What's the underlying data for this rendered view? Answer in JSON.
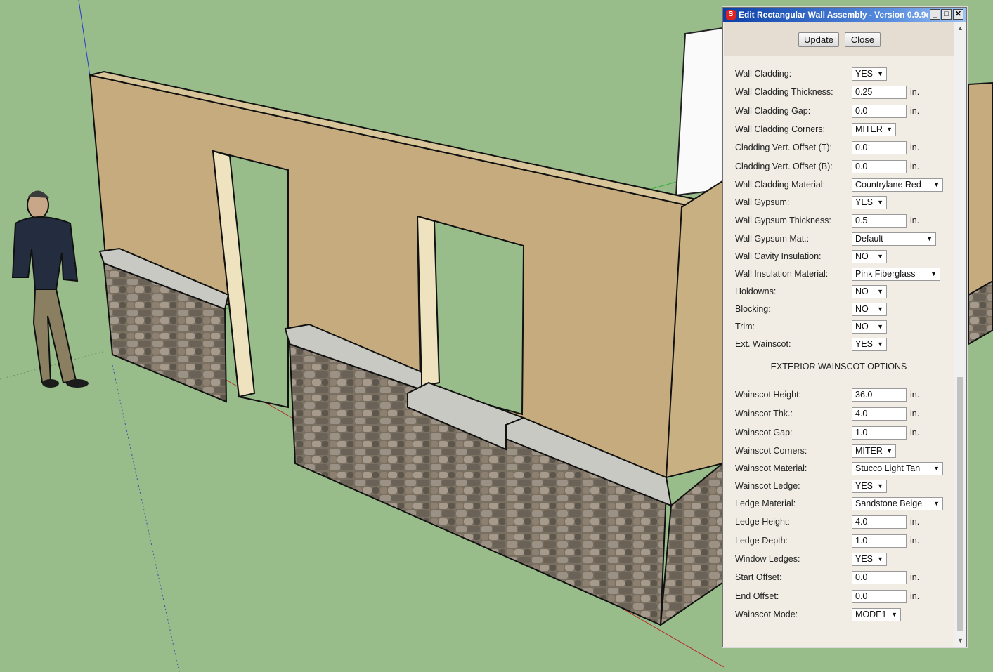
{
  "dialog": {
    "title": "Edit Rectangular Wall Assembly - Version 0.9.9c",
    "buttons": {
      "update": "Update",
      "close": "Close"
    },
    "window_controls": {
      "minimize": "_",
      "maximize": "□",
      "close": "✕"
    },
    "fields": [
      {
        "label": "Wall Cladding:",
        "type": "select",
        "value": "YES"
      },
      {
        "label": "Wall Cladding Thickness:",
        "type": "input",
        "value": "0.25",
        "unit": "in."
      },
      {
        "label": "Wall Cladding Gap:",
        "type": "input",
        "value": "0.0",
        "unit": "in."
      },
      {
        "label": "Wall Cladding Corners:",
        "type": "select",
        "value": "MITER"
      },
      {
        "label": "Cladding Vert. Offset (T):",
        "type": "input",
        "value": "0.0",
        "unit": "in."
      },
      {
        "label": "Cladding Vert. Offset (B):",
        "type": "input",
        "value": "0.0",
        "unit": "in."
      },
      {
        "label": "Wall Cladding Material:",
        "type": "select",
        "value": "Countrylane Red"
      },
      {
        "label": "Wall Gypsum:",
        "type": "select",
        "value": "YES"
      },
      {
        "label": "Wall Gypsum Thickness:",
        "type": "input",
        "value": "0.5",
        "unit": "in."
      },
      {
        "label": "Wall Gypsum Mat.:",
        "type": "select",
        "value": "Default"
      },
      {
        "label": "Wall Cavity Insulation:",
        "type": "select",
        "value": "NO"
      },
      {
        "label": "Wall Insulation Material:",
        "type": "select",
        "value": "Pink Fiberglass"
      },
      {
        "label": "Holdowns:",
        "type": "select",
        "value": "NO"
      },
      {
        "label": "Blocking:",
        "type": "select",
        "value": "NO"
      },
      {
        "label": "Trim:",
        "type": "select",
        "value": "NO"
      },
      {
        "label": "Ext. Wainscot:",
        "type": "select",
        "value": "YES"
      }
    ],
    "section_title": "EXTERIOR WAINSCOT OPTIONS",
    "wainscot_fields": [
      {
        "label": "Wainscot Height:",
        "type": "input",
        "value": "36.0",
        "unit": "in."
      },
      {
        "label": "Wainscot Thk.:",
        "type": "input",
        "value": "4.0",
        "unit": "in."
      },
      {
        "label": "Wainscot Gap:",
        "type": "input",
        "value": "1.0",
        "unit": "in."
      },
      {
        "label": "Wainscot Corners:",
        "type": "select",
        "value": "MITER"
      },
      {
        "label": "Wainscot Material:",
        "type": "select",
        "value": "Stucco Light Tan"
      },
      {
        "label": "Wainscot Ledge:",
        "type": "select",
        "value": "YES"
      },
      {
        "label": "Ledge Material:",
        "type": "select",
        "value": "Sandstone Beige"
      },
      {
        "label": "Ledge Height:",
        "type": "input",
        "value": "4.0",
        "unit": "in."
      },
      {
        "label": "Ledge Depth:",
        "type": "input",
        "value": "1.0",
        "unit": "in."
      },
      {
        "label": "Window Ledges:",
        "type": "select",
        "value": "YES"
      },
      {
        "label": "Start Offset:",
        "type": "input",
        "value": "0.0",
        "unit": "in."
      },
      {
        "label": "End Offset:",
        "type": "input",
        "value": "0.0",
        "unit": "in."
      },
      {
        "label": "Wainscot Mode:",
        "type": "select",
        "value": "MODE1"
      }
    ]
  },
  "scene": {
    "background_color": "#98bd8a",
    "wall_color": "#c5ab7d",
    "stone_color": "#7d7468",
    "ledge_color": "#c9c9c3"
  }
}
